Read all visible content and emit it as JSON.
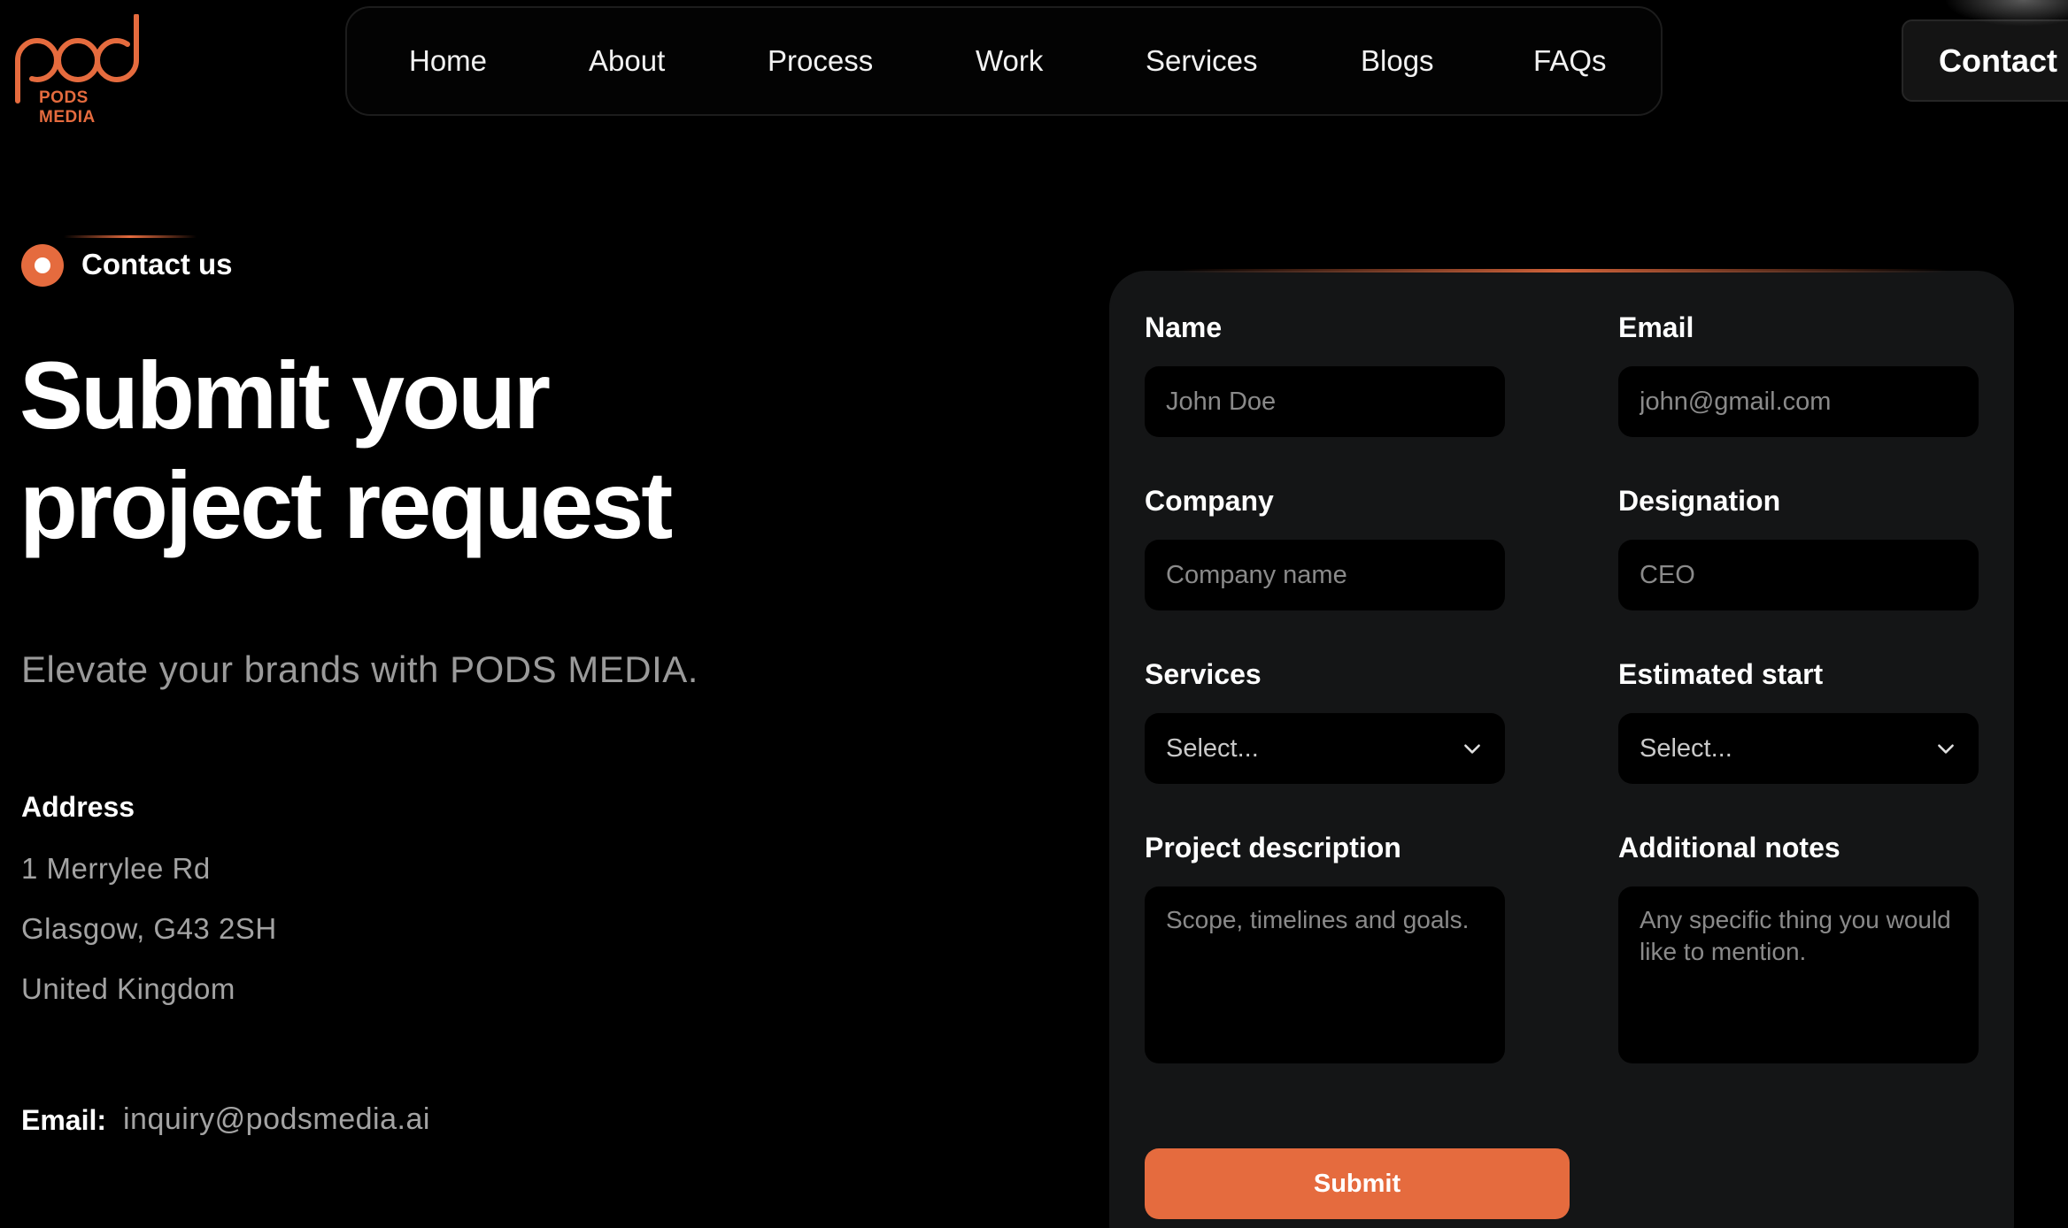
{
  "brand": {
    "logo_text": "PODS MEDIA",
    "accent_color": "#e56b3e"
  },
  "nav": {
    "items": [
      "Home",
      "About",
      "Process",
      "Work",
      "Services",
      "Blogs",
      "FAQs"
    ],
    "contact_label": "Contact"
  },
  "hero": {
    "tag": "Contact us",
    "headline_line1": "Submit your",
    "headline_line2": "project request",
    "subline": "Elevate your brands with PODS MEDIA."
  },
  "address": {
    "label": "Address",
    "lines": [
      "1 Merrylee Rd",
      "Glasgow, G43 2SH",
      "United Kingdom"
    ]
  },
  "email": {
    "label": "Email:",
    "value": "inquiry@podsmedia.ai"
  },
  "form": {
    "name": {
      "label": "Name",
      "placeholder": "John Doe"
    },
    "email": {
      "label": "Email",
      "placeholder": "john@gmail.com"
    },
    "company": {
      "label": "Company",
      "placeholder": "Company name"
    },
    "designation": {
      "label": "Designation",
      "placeholder": "CEO"
    },
    "services": {
      "label": "Services",
      "selected": "Select..."
    },
    "estimated_start": {
      "label": "Estimated start",
      "selected": "Select..."
    },
    "project_description": {
      "label": "Project description",
      "placeholder": "Scope, timelines and goals."
    },
    "additional_notes": {
      "label": "Additional notes",
      "placeholder": "Any specific thing you would like to mention."
    },
    "submit_label": "Submit"
  }
}
